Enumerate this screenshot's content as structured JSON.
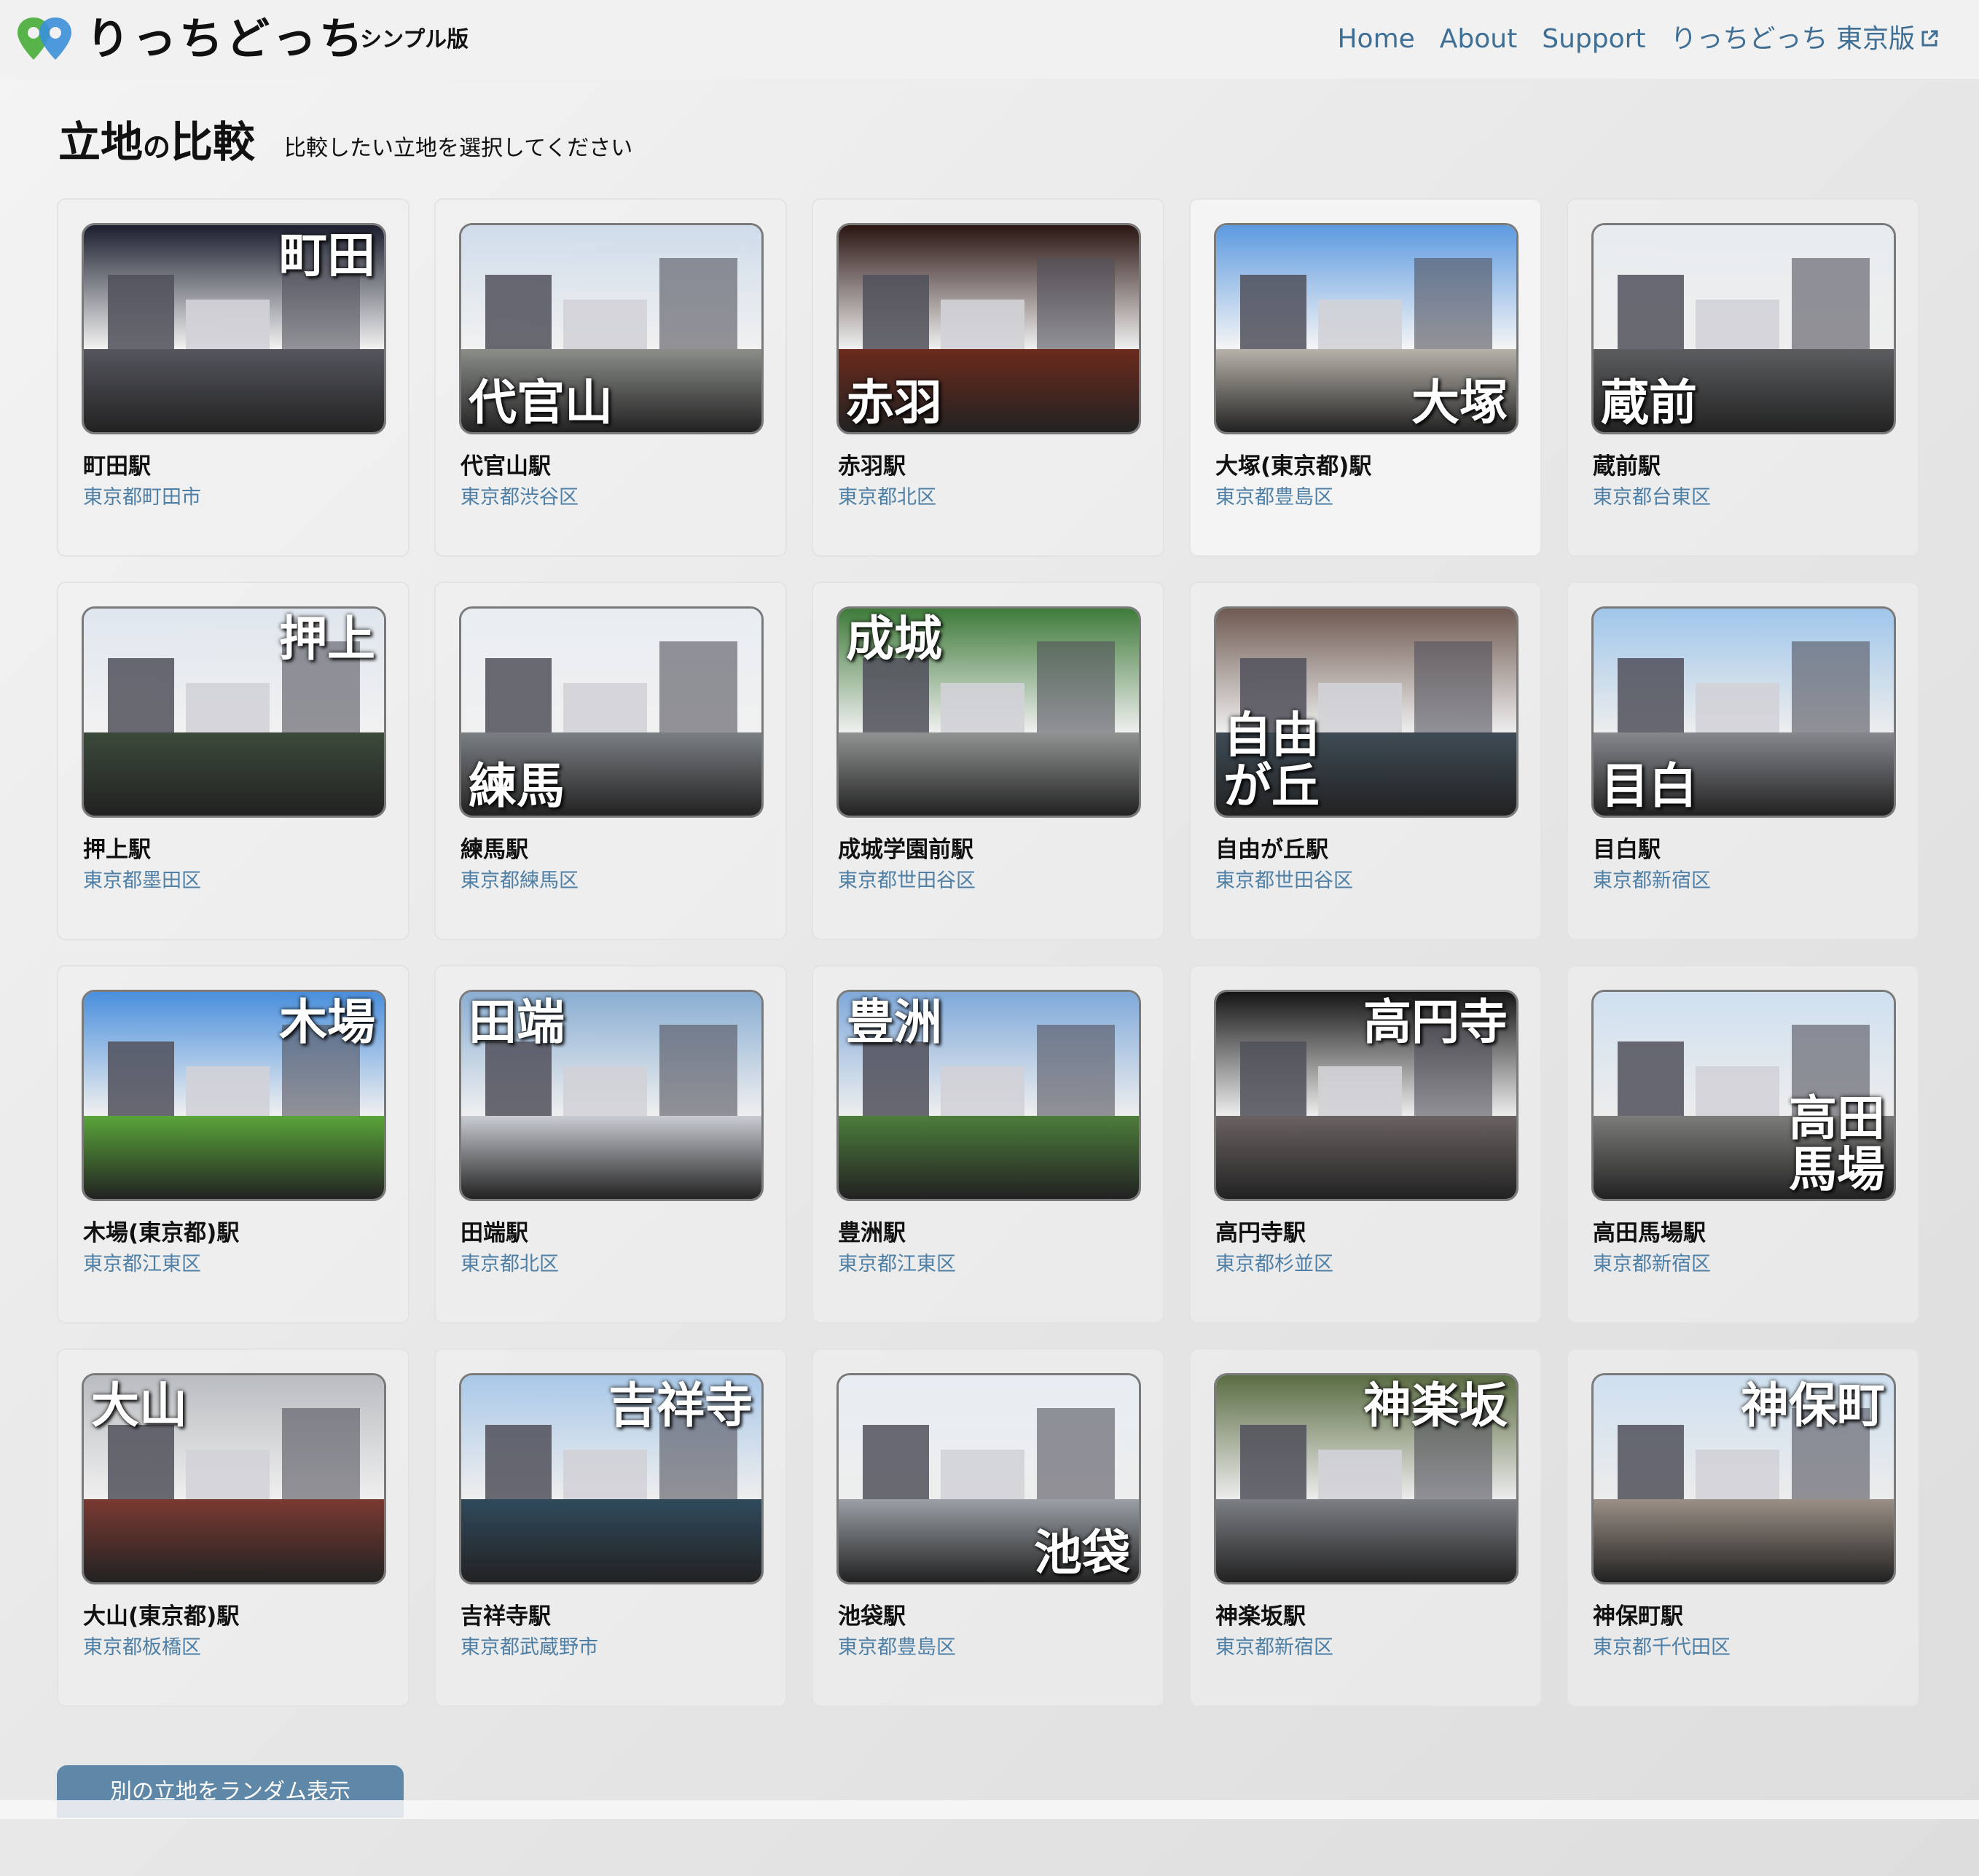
{
  "header": {
    "brand": "りっちどっち",
    "brand_sub": "シンプル版",
    "nav": [
      {
        "label": "Home"
      },
      {
        "label": "About"
      },
      {
        "label": "Support"
      },
      {
        "label": "りっちどっち 東京版",
        "external": true
      }
    ]
  },
  "page": {
    "title_part1": "立地",
    "title_part2": "の",
    "title_part3": "比較",
    "subtitle": "比較したい立地を選択してください"
  },
  "cards": [
    {
      "overlay": "町田",
      "station": "町田駅",
      "area": "東京都町田市",
      "selected": false
    },
    {
      "overlay": "代官山",
      "station": "代官山駅",
      "area": "東京都渋谷区",
      "selected": false
    },
    {
      "overlay": "赤羽",
      "station": "赤羽駅",
      "area": "東京都北区",
      "selected": false
    },
    {
      "overlay": "大塚",
      "station": "大塚(東京都)駅",
      "area": "東京都豊島区",
      "selected": true
    },
    {
      "overlay": "蔵前",
      "station": "蔵前駅",
      "area": "東京都台東区",
      "selected": false
    },
    {
      "overlay": "押上",
      "station": "押上駅",
      "area": "東京都墨田区",
      "selected": false
    },
    {
      "overlay": "練馬",
      "station": "練馬駅",
      "area": "東京都練馬区",
      "selected": false
    },
    {
      "overlay": "成城",
      "station": "成城学園前駅",
      "area": "東京都世田谷区",
      "selected": false
    },
    {
      "overlay": "自由\nが丘",
      "station": "自由が丘駅",
      "area": "東京都世田谷区",
      "selected": false
    },
    {
      "overlay": "目白",
      "station": "目白駅",
      "area": "東京都新宿区",
      "selected": false
    },
    {
      "overlay": "木場",
      "station": "木場(東京都)駅",
      "area": "東京都江東区",
      "selected": false
    },
    {
      "overlay": "田端",
      "station": "田端駅",
      "area": "東京都北区",
      "selected": false
    },
    {
      "overlay": "豊洲",
      "station": "豊洲駅",
      "area": "東京都江東区",
      "selected": false
    },
    {
      "overlay": "高円寺",
      "station": "高円寺駅",
      "area": "東京都杉並区",
      "selected": false
    },
    {
      "overlay": "高田\n馬場",
      "station": "高田馬場駅",
      "area": "東京都新宿区",
      "selected": false
    },
    {
      "overlay": "大山",
      "station": "大山(東京都)駅",
      "area": "東京都板橋区",
      "selected": false
    },
    {
      "overlay": "吉祥寺",
      "station": "吉祥寺駅",
      "area": "東京都武蔵野市",
      "selected": false
    },
    {
      "overlay": "池袋",
      "station": "池袋駅",
      "area": "東京都豊島区",
      "selected": false
    },
    {
      "overlay": "神楽坂",
      "station": "神楽坂駅",
      "area": "東京都新宿区",
      "selected": false
    },
    {
      "overlay": "神保町",
      "station": "神保町駅",
      "area": "東京都千代田区",
      "selected": false
    }
  ],
  "random_button": "別の立地をランダム表示",
  "colors": {
    "nav_link": "#3f6f94",
    "area_text": "#4e7fa6",
    "button_bg": "#5f88a8",
    "logo_green": "#58b44a",
    "logo_blue": "#3b8fd9"
  }
}
